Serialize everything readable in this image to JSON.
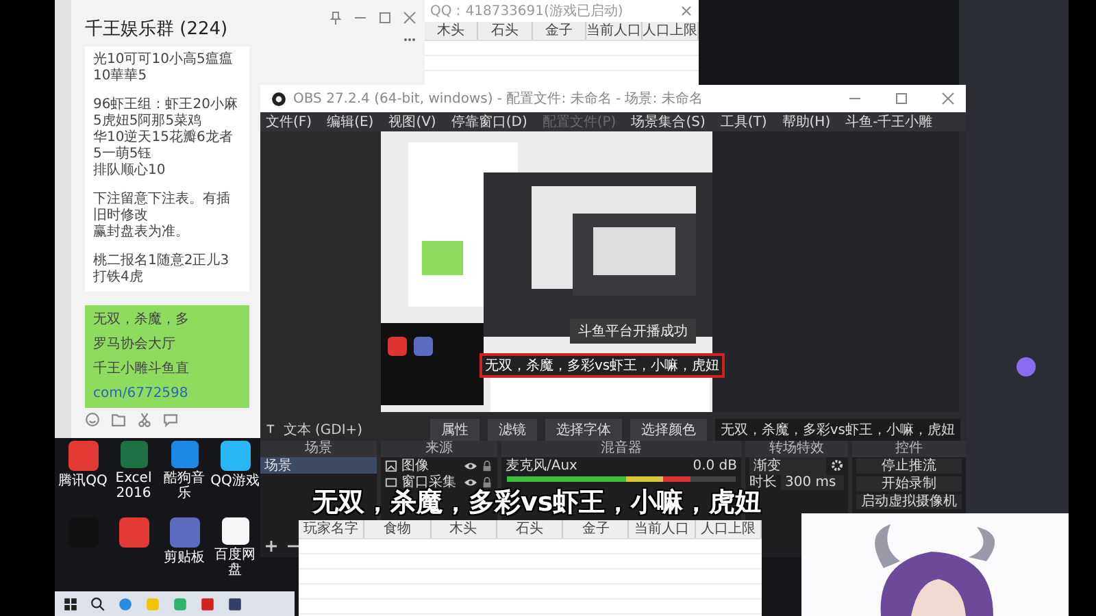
{
  "chat": {
    "title": "千王娱乐群 (224)",
    "groups": [
      {
        "lines": [
          "光10可可10小高5瘟瘟10華華5"
        ]
      },
      {
        "lines": [
          "96虾王组：虾王20小麻5虎妞5阿那5菜鸡",
          "华10逆天15花瓣6龙者5一萌5钰",
          "排队顺心10"
        ]
      },
      {
        "lines": [
          "下注留意下注表。有插旧时修改",
          "赢封盘表为准。"
        ]
      },
      {
        "lines": [
          "桃二报名1随意2正儿3打铁4虎"
        ]
      }
    ],
    "bubble": {
      "lines": [
        "无双，杀魔，多",
        "罗马协会大厅",
        "千王小雕斗鱼直"
      ],
      "link": "com/6772598"
    }
  },
  "stats_window": {
    "title": "QQ：418733691(游戏已启动)",
    "columns": [
      "木头",
      "石头",
      "金子",
      "当前人口",
      "人口上限"
    ]
  },
  "obs": {
    "title": "OBS 27.2.4 (64-bit, windows) - 配置文件: 未命名 - 场景: 未命名",
    "menu": [
      {
        "label": "文件(F)",
        "disabled": false
      },
      {
        "label": "编辑(E)",
        "disabled": false
      },
      {
        "label": "视图(V)",
        "disabled": false
      },
      {
        "label": "停靠窗口(D)",
        "disabled": false
      },
      {
        "label": "配置文件(P)",
        "disabled": true
      },
      {
        "label": "场景集合(S)",
        "disabled": false
      },
      {
        "label": "工具(T)",
        "disabled": false
      },
      {
        "label": "帮助(H)",
        "disabled": false
      },
      {
        "label": "斗鱼-千王小雕",
        "disabled": false
      }
    ],
    "preview": {
      "toast": "斗鱼平台开播成功",
      "caption": "无双，杀魔，多彩vs虾王，小嘛，虎妞"
    },
    "source_bar": {
      "source": "文本 (GDI+)",
      "properties": "属性",
      "filters": "滤镜",
      "font_button": "选择字体",
      "color_button": "选择颜色",
      "text": "无双，杀魔，多彩vs虾王，小嘛，虎妞"
    },
    "scenes": {
      "title": "场景",
      "items": [
        {
          "label": "场景",
          "selected": true
        }
      ]
    },
    "sources": {
      "title": "来源",
      "items": [
        {
          "label": "图像",
          "kind": "image"
        },
        {
          "label": "窗口采集",
          "kind": "window"
        }
      ]
    },
    "mixer": {
      "title": "混音器",
      "channels": [
        {
          "name": "麦克风/Aux",
          "reading": "0.0 dB",
          "level": 0.8
        }
      ]
    },
    "transitions": {
      "title": "转场特效",
      "type": "渐变",
      "duration_label": "时长",
      "duration": "300 ms"
    },
    "controls": {
      "title": "控件",
      "buttons": [
        "停止推流",
        "开始录制",
        "启动虚拟摄像机"
      ]
    }
  },
  "overlay_caption": "无双，杀魔，多彩vs虾王，小嘛，虎妞",
  "player_table": {
    "columns": [
      "玩家名字",
      "食物",
      "木头",
      "石头",
      "金子",
      "当前人口",
      "人口上限"
    ]
  },
  "desktop_icons": [
    {
      "label": "腾讯QQ",
      "color": "#e53935"
    },
    {
      "label": "Excel 2016",
      "color": "#1e7145"
    },
    {
      "label": "酷狗音乐",
      "color": "#1e88e5"
    },
    {
      "label": "QQ游戏",
      "color": "#29b6f6"
    },
    {
      "color": "#111111"
    },
    {
      "color": "#e53935"
    },
    {
      "label": "剪贴板",
      "color": "#5c6bc0"
    },
    {
      "label": "百度网盘",
      "color": "#f5f5f5"
    }
  ]
}
